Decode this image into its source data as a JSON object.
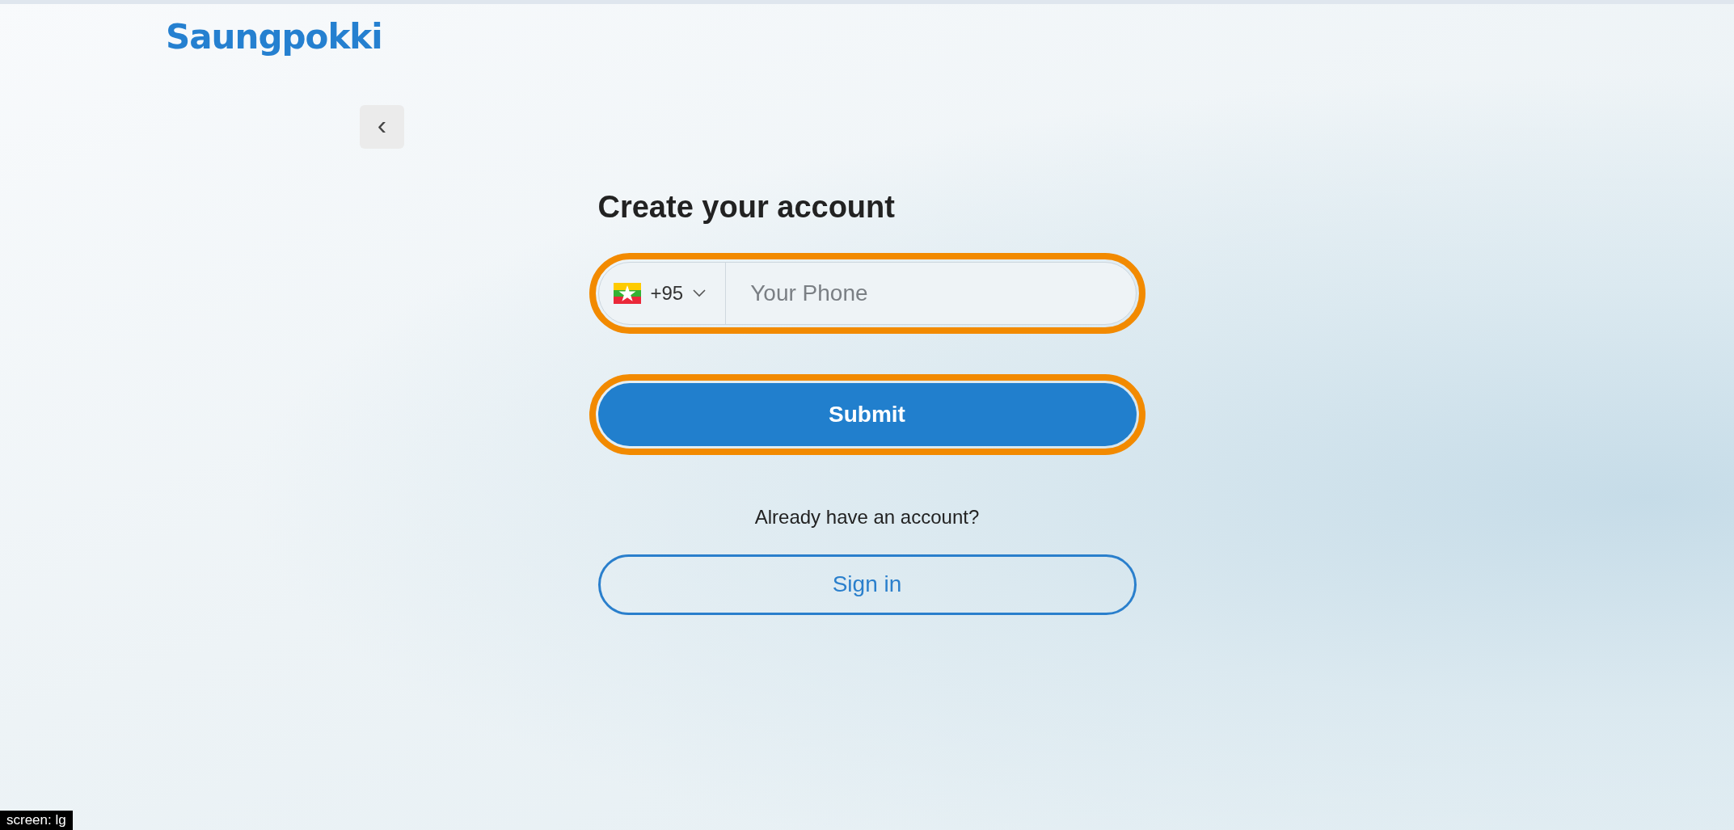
{
  "logo": {
    "text": "Saungpokki"
  },
  "back_button": {
    "label": "‹"
  },
  "title": "Create your account",
  "phone_field": {
    "country_code": "+95",
    "placeholder": "Your Phone",
    "highlighted": true
  },
  "submit_button": {
    "label": "Submit",
    "highlighted": true
  },
  "signin_prompt": "Already have an account?",
  "signin_button": {
    "label": "Sign in",
    "highlighted": false
  },
  "screen_badge": "screen: lg"
}
